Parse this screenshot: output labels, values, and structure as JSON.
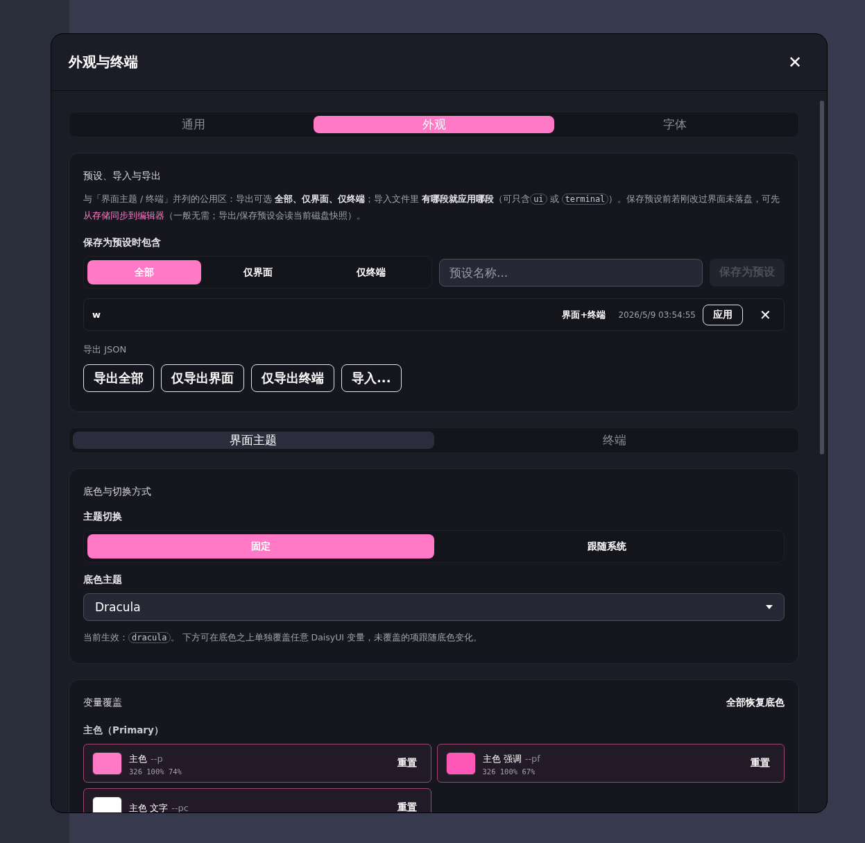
{
  "dialog": {
    "title": "外观与终端",
    "close": "✕"
  },
  "tabs": [
    {
      "label": "通用",
      "selected": false
    },
    {
      "label": "外观",
      "selected": true
    },
    {
      "label": "字体",
      "selected": false
    }
  ],
  "presets": {
    "title": "预设、导入与导出",
    "description": "与「界面主题 / 终端」并列的公用区：导出可选 **全部、仅界面、仅终端**；导入文件里 **有哪段就应用哪段**（可只含",
    "code_1": "ui",
    "between": "或",
    "code_2": "terminal",
    "after": "）。保存预设前若刚改过界面未落盘，可先",
    "link": "从存储同步到编辑器",
    "tail": "（一般无需；导出/保存预设会读当前磁盘快照）。",
    "include_label": "保存为预设时包含",
    "scope": [
      {
        "label": "全部",
        "selected": true
      },
      {
        "label": "仅界面",
        "selected": false
      },
      {
        "label": "仅终端",
        "selected": false
      }
    ],
    "name_field": {
      "placeholder": "预设名称..."
    },
    "save_button": {
      "label": "保存为预设",
      "disabled": true
    },
    "saved": [
      {
        "name": "w",
        "scope": "界面+终端",
        "time": "2026/5/9 03:54:55",
        "apply": "应用",
        "delete": "✕"
      }
    ],
    "export_label": "导出 JSON",
    "export_buttons": [
      "导出全部",
      "仅导出界面",
      "仅导出终端",
      "导入..."
    ]
  },
  "sub_tabs": [
    {
      "label": "界面主题",
      "selected": true
    },
    {
      "label": "终端",
      "selected": false
    }
  ],
  "base": {
    "title": "底色与切换方式",
    "switch_label": "主题切换",
    "switch": [
      {
        "label": "固定",
        "selected": true
      },
      {
        "label": "跟随系统",
        "selected": false
      }
    ],
    "theme_label": "底色主题",
    "theme_value": "Dracula",
    "note_before": "当前生效：",
    "note_code": "dracula",
    "note_after": "。 下方可在底色之上单独覆盖任意 DaisyUI 变量，未覆盖的项跟随底色变化。"
  },
  "overrides": {
    "title": "变量覆盖",
    "reset_all": "全部恢复底色",
    "group": "主色（Primary）",
    "vars": [
      {
        "name": "主色",
        "var": "--p",
        "value": "326 100% 74%",
        "color": "#ff79c6",
        "reset": "重置"
      },
      {
        "name": "主色 强调",
        "var": "--pf",
        "value": "326 100% 67%",
        "color": "#ff57b8",
        "reset": "重置"
      },
      {
        "name": "主色 文字",
        "var": "--pc",
        "color": "#ffffff",
        "reset": "重置"
      }
    ]
  }
}
